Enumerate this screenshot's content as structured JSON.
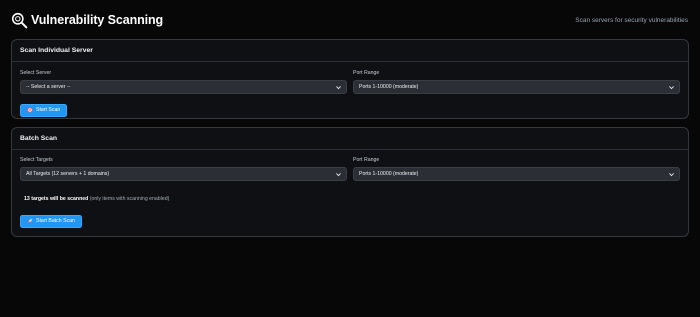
{
  "header": {
    "title": "Vulnerability Scanning",
    "subtitle": "Scan servers for security vulnerabilities",
    "icon": "magnifier-search-icon"
  },
  "individual_scan": {
    "title": "Scan Individual Server",
    "server_label": "Select Server",
    "server_value": "-- Select a server --",
    "port_label": "Port Range",
    "port_value": "Ports 1-10000 (moderate)",
    "button_label": "Start Scan",
    "button_icon": "target-icon"
  },
  "batch_scan": {
    "title": "Batch Scan",
    "targets_label": "Select Targets",
    "targets_value": "All Targets (12 servers + 1 domains)",
    "port_label": "Port Range",
    "port_value": "Ports 1-10000 (moderate)",
    "count_text": "13 targets will be scanned",
    "count_note": "(only items with scanning enabled)",
    "button_label": "Start Batch Scan",
    "button_icon": "rocket-icon"
  },
  "colors": {
    "background": "#070708",
    "card": "#0f1013",
    "accent": "#2196f3",
    "input": "#2b2f35"
  }
}
